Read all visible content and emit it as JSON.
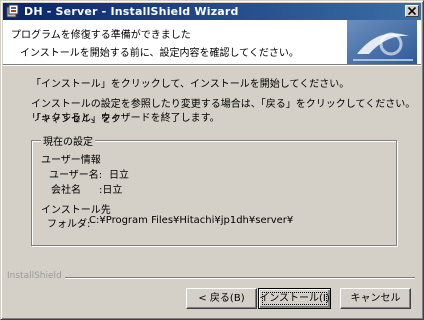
{
  "window": {
    "title": "DH - Server - InstallShield Wizard"
  },
  "header": {
    "title": "プログラムを修復する準備ができました",
    "subtitle": "インストールを開始する前に、設定内容を確認してください。"
  },
  "body": {
    "paragraph1": "「インストール」をクリックして、インストールを開始してください。",
    "paragraph2_line1": "インストールの設定を参照したり変更する場合は、「戻る」をクリックしてください。「キャンセル」をク",
    "paragraph2_line2": "リックすると、ウィザードを終了します。"
  },
  "settings": {
    "group_label": "現在の設定",
    "user_info_label": "ユーザー情報",
    "username_label": "ユーザー名:",
    "username_value": "日立",
    "company_label": "会社名",
    "company_value": ":日立",
    "install_dest_label": "インストール先",
    "folder_label": "フォルダ:",
    "folder_value": "C:¥Program Files¥Hitachi¥jp1dh¥server¥"
  },
  "footer": {
    "brand": "InstallShield",
    "back_label": "< 戻る(B)",
    "install_label": "インストール(I)",
    "cancel_label": "キャンセル"
  },
  "colors": {
    "titlebar_start": "#0a246a",
    "titlebar_end": "#3a6ea5",
    "dialog_bg": "#d4d0c8"
  }
}
